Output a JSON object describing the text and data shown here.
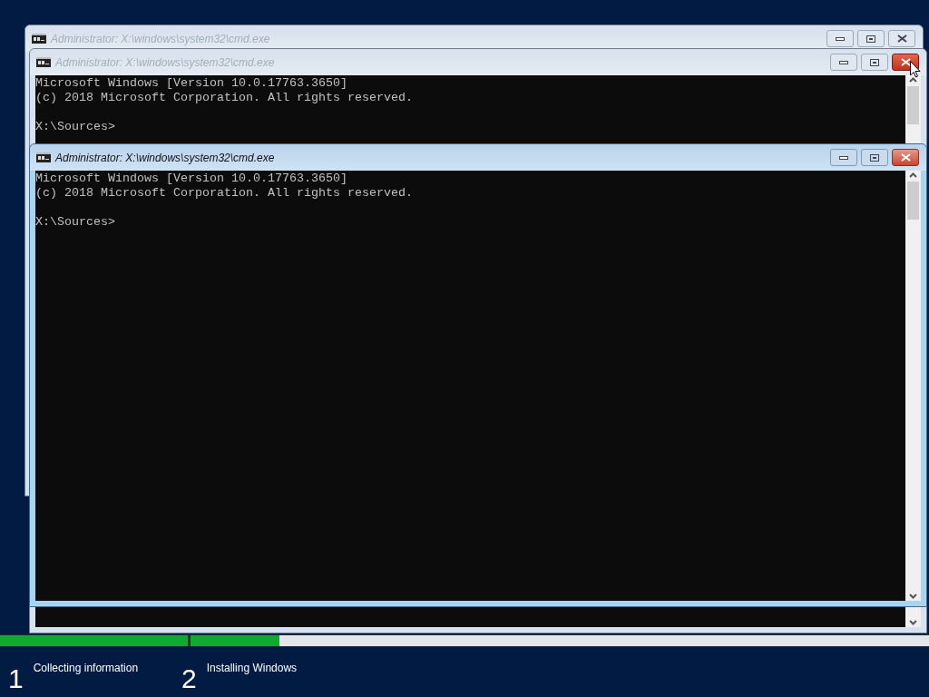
{
  "windows": [
    {
      "title": "Administrator: X:\\windows\\system32\\cmd.exe",
      "active": false,
      "close_hovered": false
    },
    {
      "title": "Administrator: X:\\windows\\system32\\cmd.exe",
      "active": false,
      "close_hovered": true,
      "lines": [
        "Microsoft Windows [Version 10.0.17763.3650]",
        "(c) 2018 Microsoft Corporation. All rights reserved."
      ],
      "prompt": "X:\\Sources>"
    },
    {
      "title": "Administrator: X:\\windows\\system32\\cmd.exe",
      "active": true,
      "close_hovered": false,
      "lines": [
        "Microsoft Windows [Version 10.0.17763.3650]",
        "(c) 2018 Microsoft Corporation. All rights reserved."
      ],
      "prompt": "X:\\Sources>"
    }
  ],
  "steps": [
    {
      "number": "1",
      "label": "Collecting information",
      "level": 1
    },
    {
      "number": "2",
      "label": "Installing Windows",
      "level": 0.12
    }
  ]
}
